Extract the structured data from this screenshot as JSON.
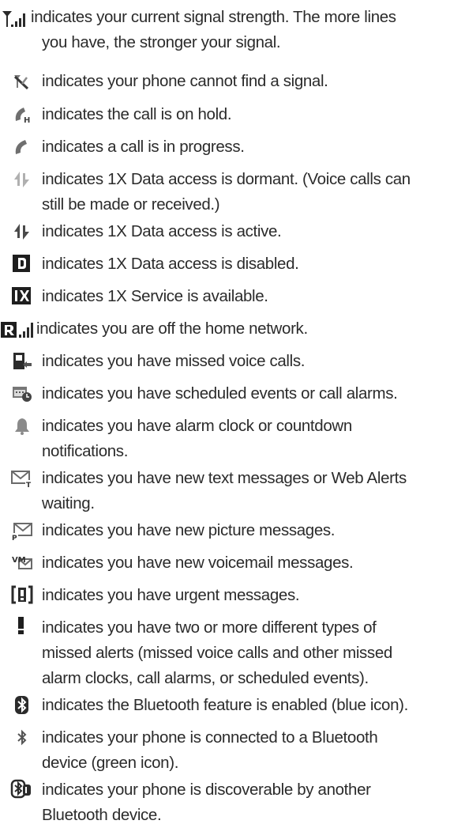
{
  "entries": [
    {
      "icon": "signal-strength-icon",
      "lines": [
        "indicates your current signal strength. The more lines",
        "you have, the stronger your signal."
      ]
    },
    {
      "icon": "no-signal-icon",
      "lines": [
        "indicates your phone cannot find a signal."
      ]
    },
    {
      "icon": "call-on-hold-icon",
      "lines": [
        "indicates the call is on hold."
      ]
    },
    {
      "icon": "call-in-progress-icon",
      "lines": [
        "indicates a call is in progress."
      ]
    },
    {
      "icon": "data-dormant-icon",
      "lines": [
        "indicates 1X Data access is dormant. (Voice calls can",
        "still be made or received.)"
      ]
    },
    {
      "icon": "data-active-icon",
      "lines": [
        "indicates 1X Data access is active."
      ]
    },
    {
      "icon": "data-disabled-icon",
      "lines": [
        "indicates 1X Data access is disabled."
      ]
    },
    {
      "icon": "1x-service-icon",
      "lines": [
        "indicates 1X Service is available."
      ]
    },
    {
      "icon": "roaming-icon",
      "lines": [
        "indicates you are off the home network."
      ]
    },
    {
      "icon": "missed-call-icon",
      "lines": [
        "indicates you have missed voice calls."
      ]
    },
    {
      "icon": "scheduled-event-icon",
      "lines": [
        "indicates you have scheduled events or call alarms."
      ]
    },
    {
      "icon": "alarm-bell-icon",
      "lines": [
        "indicates you have alarm clock or countdown",
        "notifications."
      ]
    },
    {
      "icon": "text-message-icon",
      "lines": [
        "indicates you have new text messages or Web Alerts",
        "waiting."
      ]
    },
    {
      "icon": "picture-message-icon",
      "lines": [
        "indicates you have new picture messages."
      ]
    },
    {
      "icon": "voicemail-icon",
      "lines": [
        "indicates you have new voicemail messages."
      ]
    },
    {
      "icon": "urgent-message-icon",
      "lines": [
        "indicates you have urgent messages."
      ]
    },
    {
      "icon": "multiple-alerts-icon",
      "lines": [
        "indicates you have two or more different types of",
        "missed alerts (missed voice calls and other missed",
        "alarm clocks, call alarms, or scheduled events)."
      ]
    },
    {
      "icon": "bluetooth-enabled-icon",
      "lines": [
        "indicates the Bluetooth feature is enabled (blue icon)."
      ]
    },
    {
      "icon": "bluetooth-connected-icon",
      "lines": [
        "indicates your phone is connected to a Bluetooth",
        "device (green icon)."
      ]
    },
    {
      "icon": "bluetooth-discoverable-icon",
      "lines": [
        "indicates your phone is discoverable by another",
        "Bluetooth device."
      ]
    }
  ]
}
